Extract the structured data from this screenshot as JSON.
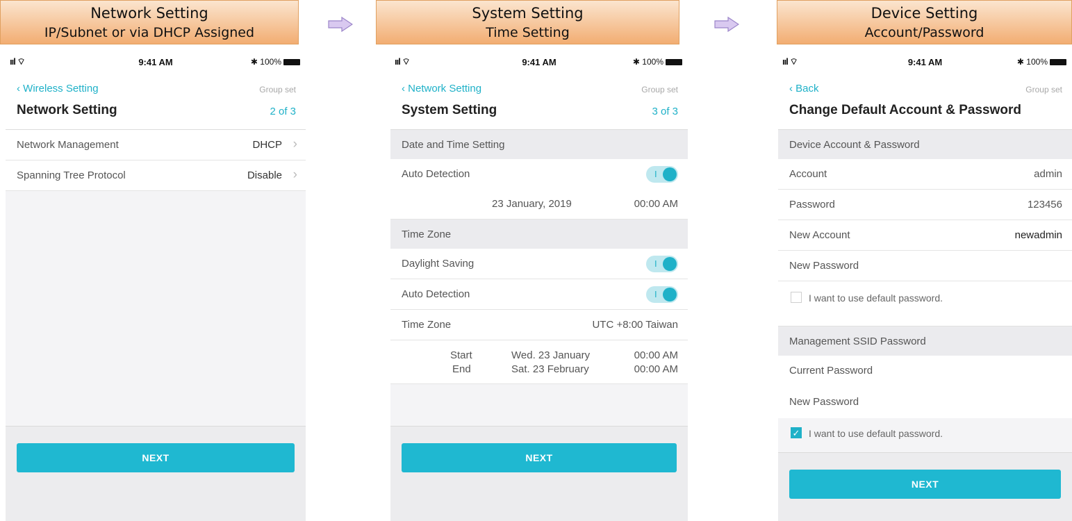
{
  "banners": [
    {
      "line1": "Network Setting",
      "line2": "IP/Subnet or via DHCP Assigned"
    },
    {
      "line1": "System Setting",
      "line2": "Time Setting"
    },
    {
      "line1": "Device Setting",
      "line2": "Account/Password"
    }
  ],
  "status": {
    "time": "9:41 AM",
    "signal": "ııl ⌔",
    "battery": "✱ 100%"
  },
  "screen1": {
    "back": "‹ Wireless Setting",
    "group_set": "Group set",
    "title": "Network Setting",
    "step": "2 of 3",
    "rows": [
      {
        "label": "Network Management",
        "value": "DHCP"
      },
      {
        "label": "Spanning Tree Protocol",
        "value": "Disable"
      }
    ],
    "next": "NEXT"
  },
  "screen2": {
    "back": "‹ Network Setting",
    "group_set": "Group set",
    "title": "System Setting",
    "step": "3 of 3",
    "section_datetime": "Date and Time Setting",
    "auto_detection": "Auto Detection",
    "date": "23 January, 2019",
    "time": "00:00 AM",
    "section_timezone": "Time Zone",
    "daylight_saving": "Daylight Saving",
    "auto_detection2": "Auto Detection",
    "timezone_label": "Time Zone",
    "timezone_value": "UTC +8:00 Taiwan",
    "start_label": "Start",
    "start_date": "Wed. 23 January",
    "start_time": "00:00 AM",
    "end_label": "End",
    "end_date": "Sat. 23 February",
    "end_time": "00:00 AM",
    "next": "NEXT"
  },
  "screen3": {
    "back": "‹ Back",
    "group_set": "Group set",
    "title": "Change Default Account & Password",
    "section_account": "Device Account & Password",
    "account_label": "Account",
    "account_value": "admin",
    "password_label": "Password",
    "password_value": "123456",
    "new_account_label": "New Account",
    "new_account_value": "newadmin",
    "new_password_label": "New Password",
    "default_pw_1": "I want to use default password.",
    "section_ssid": "Management SSID Password",
    "current_password": "Current Password",
    "new_password2": "New Password",
    "default_pw_2": "I want to use default password.",
    "next": "NEXT"
  },
  "colors": {
    "accent": "#1fb8d1",
    "banner": "#f2ad72",
    "arrow": "#c9b3e6"
  }
}
